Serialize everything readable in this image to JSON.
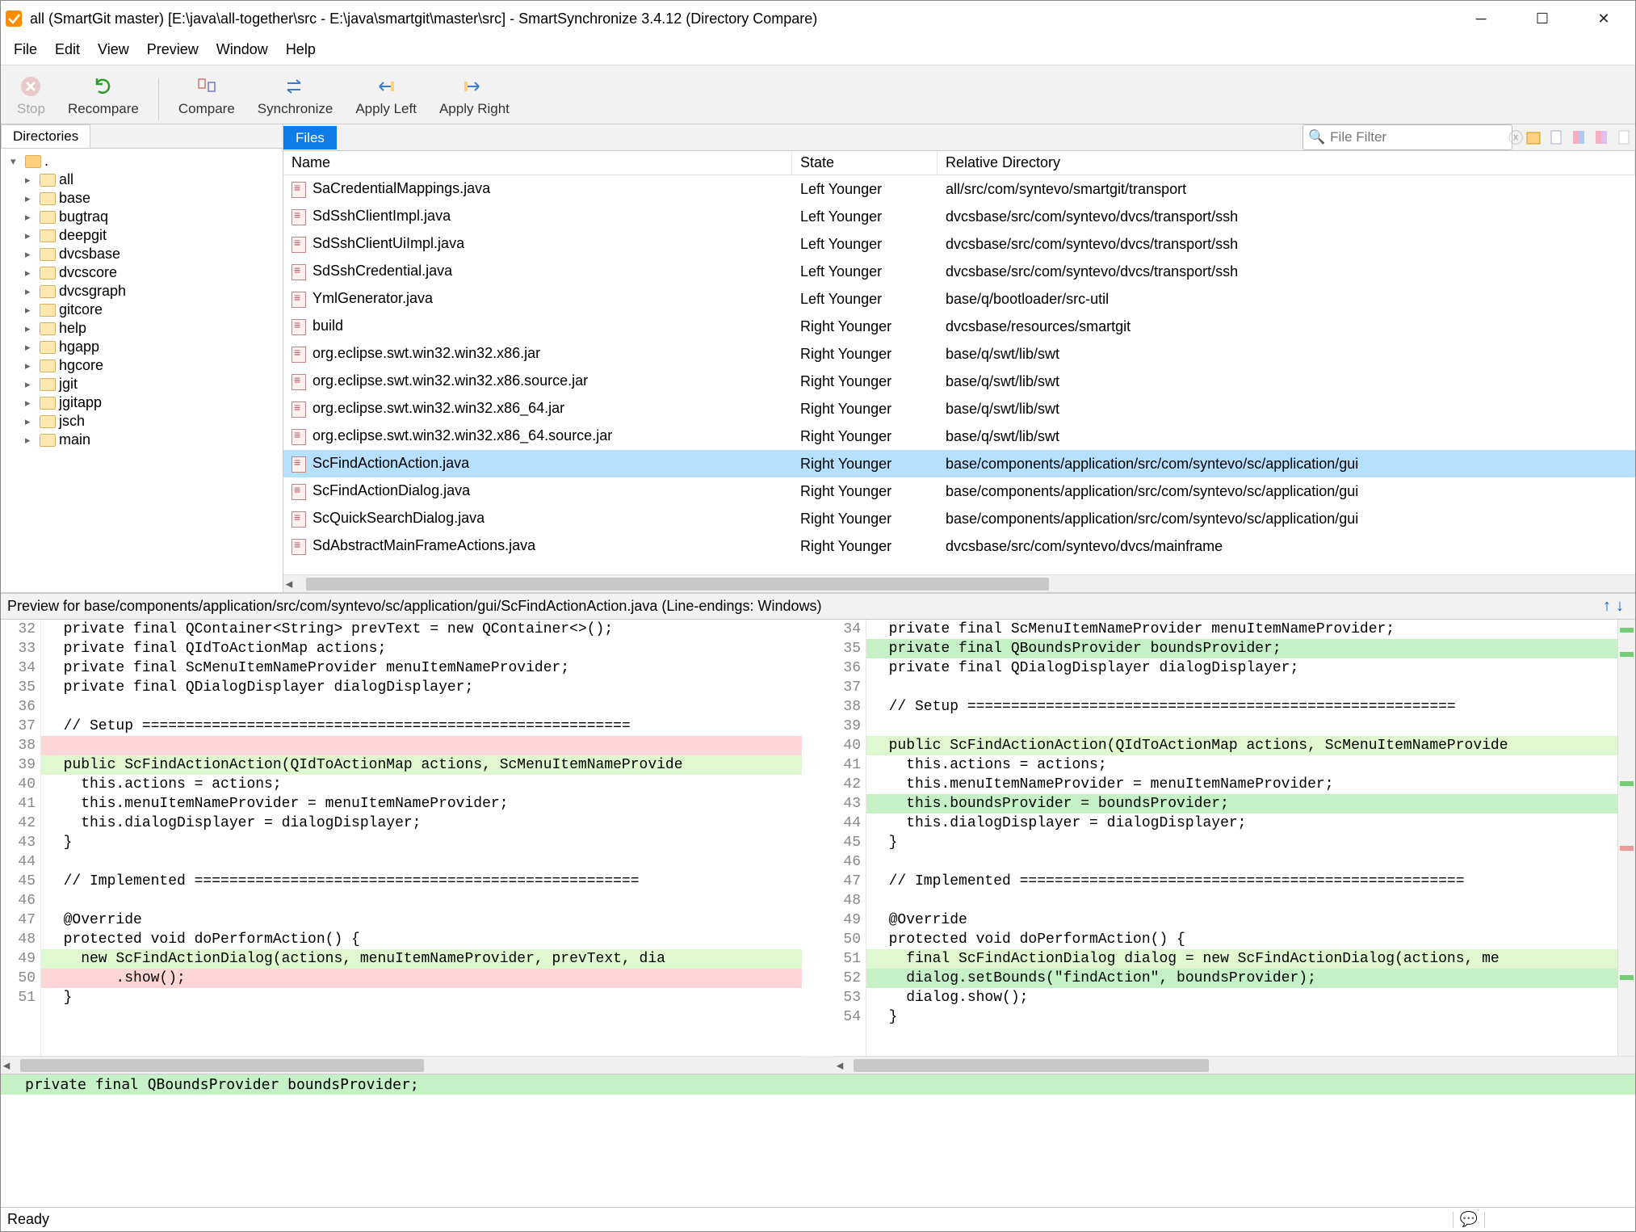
{
  "window": {
    "title": "all (SmartGit master) [E:\\java\\all-together\\src - E:\\java\\smartgit\\master\\src] - SmartSynchronize 3.4.12 (Directory Compare)"
  },
  "menu": {
    "items": [
      "File",
      "Edit",
      "View",
      "Preview",
      "Window",
      "Help"
    ]
  },
  "toolbar": {
    "stop": "Stop",
    "recompare": "Recompare",
    "compare": "Compare",
    "synchronize": "Synchronize",
    "applyLeft": "Apply Left",
    "applyRight": "Apply Right"
  },
  "tabs": {
    "directories": "Directories",
    "files": "Files"
  },
  "filter": {
    "placeholder": "File Filter"
  },
  "dirtree": {
    "root": ".",
    "items": [
      "all",
      "base",
      "bugtraq",
      "deepgit",
      "dvcsbase",
      "dvcscore",
      "dvcsgraph",
      "gitcore",
      "help",
      "hgapp",
      "hgcore",
      "jgit",
      "jgitapp",
      "jsch",
      "main"
    ]
  },
  "filescols": {
    "name": "Name",
    "state": "State",
    "reldir": "Relative Directory"
  },
  "files": [
    {
      "name": "SaCredentialMappings.java",
      "state": "Left Younger",
      "rel": "all/src/com/syntevo/smartgit/transport"
    },
    {
      "name": "SdSshClientImpl.java",
      "state": "Left Younger",
      "rel": "dvcsbase/src/com/syntevo/dvcs/transport/ssh"
    },
    {
      "name": "SdSshClientUiImpl.java",
      "state": "Left Younger",
      "rel": "dvcsbase/src/com/syntevo/dvcs/transport/ssh"
    },
    {
      "name": "SdSshCredential.java",
      "state": "Left Younger",
      "rel": "dvcsbase/src/com/syntevo/dvcs/transport/ssh"
    },
    {
      "name": "YmlGenerator.java",
      "state": "Left Younger",
      "rel": "base/q/bootloader/src-util"
    },
    {
      "name": "build",
      "state": "Right Younger",
      "rel": "dvcsbase/resources/smartgit"
    },
    {
      "name": "org.eclipse.swt.win32.win32.x86.jar",
      "state": "Right Younger",
      "rel": "base/q/swt/lib/swt"
    },
    {
      "name": "org.eclipse.swt.win32.win32.x86.source.jar",
      "state": "Right Younger",
      "rel": "base/q/swt/lib/swt"
    },
    {
      "name": "org.eclipse.swt.win32.win32.x86_64.jar",
      "state": "Right Younger",
      "rel": "base/q/swt/lib/swt"
    },
    {
      "name": "org.eclipse.swt.win32.win32.x86_64.source.jar",
      "state": "Right Younger",
      "rel": "base/q/swt/lib/swt"
    },
    {
      "name": "ScFindActionAction.java",
      "state": "Right Younger",
      "rel": "base/components/application/src/com/syntevo/sc/application/gui",
      "selected": true
    },
    {
      "name": "ScFindActionDialog.java",
      "state": "Right Younger",
      "rel": "base/components/application/src/com/syntevo/sc/application/gui"
    },
    {
      "name": "ScQuickSearchDialog.java",
      "state": "Right Younger",
      "rel": "base/components/application/src/com/syntevo/sc/application/gui"
    },
    {
      "name": "SdAbstractMainFrameActions.java",
      "state": "Right Younger",
      "rel": "dvcsbase/src/com/syntevo/dvcs/mainframe"
    }
  ],
  "preview": {
    "header": "Preview for base/components/application/src/com/syntevo/sc/application/gui/ScFindActionAction.java (Line-endings: Windows)"
  },
  "diff": {
    "left": [
      {
        "n": 32,
        "t": "  private final QContainer<String> prevText = new QContainer<>();"
      },
      {
        "n": 33,
        "t": "  private final QIdToActionMap actions;"
      },
      {
        "n": 34,
        "t": "  private final ScMenuItemNameProvider menuItemNameProvider;"
      },
      {
        "n": 35,
        "t": "  private final QDialogDisplayer dialogDisplayer;"
      },
      {
        "n": 36,
        "t": ""
      },
      {
        "n": 37,
        "t": "  // Setup ========================================================"
      },
      {
        "n": 38,
        "t": "",
        "cls": "del"
      },
      {
        "n": 39,
        "t": "  public ScFindActionAction(QIdToActionMap actions, ScMenuItemNameProvide",
        "cls": "chg"
      },
      {
        "n": 40,
        "t": "    this.actions = actions;"
      },
      {
        "n": 41,
        "t": "    this.menuItemNameProvider = menuItemNameProvider;"
      },
      {
        "n": 42,
        "t": "    this.dialogDisplayer = dialogDisplayer;"
      },
      {
        "n": 43,
        "t": "  }"
      },
      {
        "n": 44,
        "t": ""
      },
      {
        "n": 45,
        "t": "  // Implemented ==================================================="
      },
      {
        "n": 46,
        "t": ""
      },
      {
        "n": 47,
        "t": "  @Override"
      },
      {
        "n": 48,
        "t": "  protected void doPerformAction() {"
      },
      {
        "n": 49,
        "t": "    new ScFindActionDialog(actions, menuItemNameProvider, prevText, dia",
        "cls": "chg"
      },
      {
        "n": 50,
        "t": "        .show();",
        "cls": "del"
      },
      {
        "n": 51,
        "t": "  }"
      }
    ],
    "right": [
      {
        "n": 34,
        "t": "  private final ScMenuItemNameProvider menuItemNameProvider;"
      },
      {
        "n": 35,
        "t": "  private final QBoundsProvider boundsProvider;",
        "cls": "add"
      },
      {
        "n": 36,
        "t": "  private final QDialogDisplayer dialogDisplayer;"
      },
      {
        "n": 37,
        "t": ""
      },
      {
        "n": 38,
        "t": "  // Setup ========================================================"
      },
      {
        "n": 39,
        "t": ""
      },
      {
        "n": 40,
        "t": "  public ScFindActionAction(QIdToActionMap actions, ScMenuItemNameProvide",
        "cls": "chg"
      },
      {
        "n": 41,
        "t": "    this.actions = actions;"
      },
      {
        "n": 42,
        "t": "    this.menuItemNameProvider = menuItemNameProvider;"
      },
      {
        "n": 43,
        "t": "    this.boundsProvider = boundsProvider;",
        "cls": "add"
      },
      {
        "n": 44,
        "t": "    this.dialogDisplayer = dialogDisplayer;"
      },
      {
        "n": 45,
        "t": "  }"
      },
      {
        "n": 46,
        "t": ""
      },
      {
        "n": 47,
        "t": "  // Implemented ==================================================="
      },
      {
        "n": 48,
        "t": ""
      },
      {
        "n": 49,
        "t": "  @Override"
      },
      {
        "n": 50,
        "t": "  protected void doPerformAction() {"
      },
      {
        "n": 51,
        "t": "    final ScFindActionDialog dialog = new ScFindActionDialog(actions, me",
        "cls": "chg"
      },
      {
        "n": 52,
        "t": "    dialog.setBounds(\"findAction\", boundsProvider);",
        "cls": "add"
      },
      {
        "n": 53,
        "t": "    dialog.show();"
      },
      {
        "n": 54,
        "t": "  }"
      }
    ]
  },
  "bottomline": "  private final QBoundsProvider boundsProvider;",
  "status": {
    "text": "Ready"
  },
  "colors": {
    "selection": "#b6e0ff",
    "add": "#c6f0c6",
    "del": "#ffd6d6",
    "accent": "#0e7be8"
  }
}
